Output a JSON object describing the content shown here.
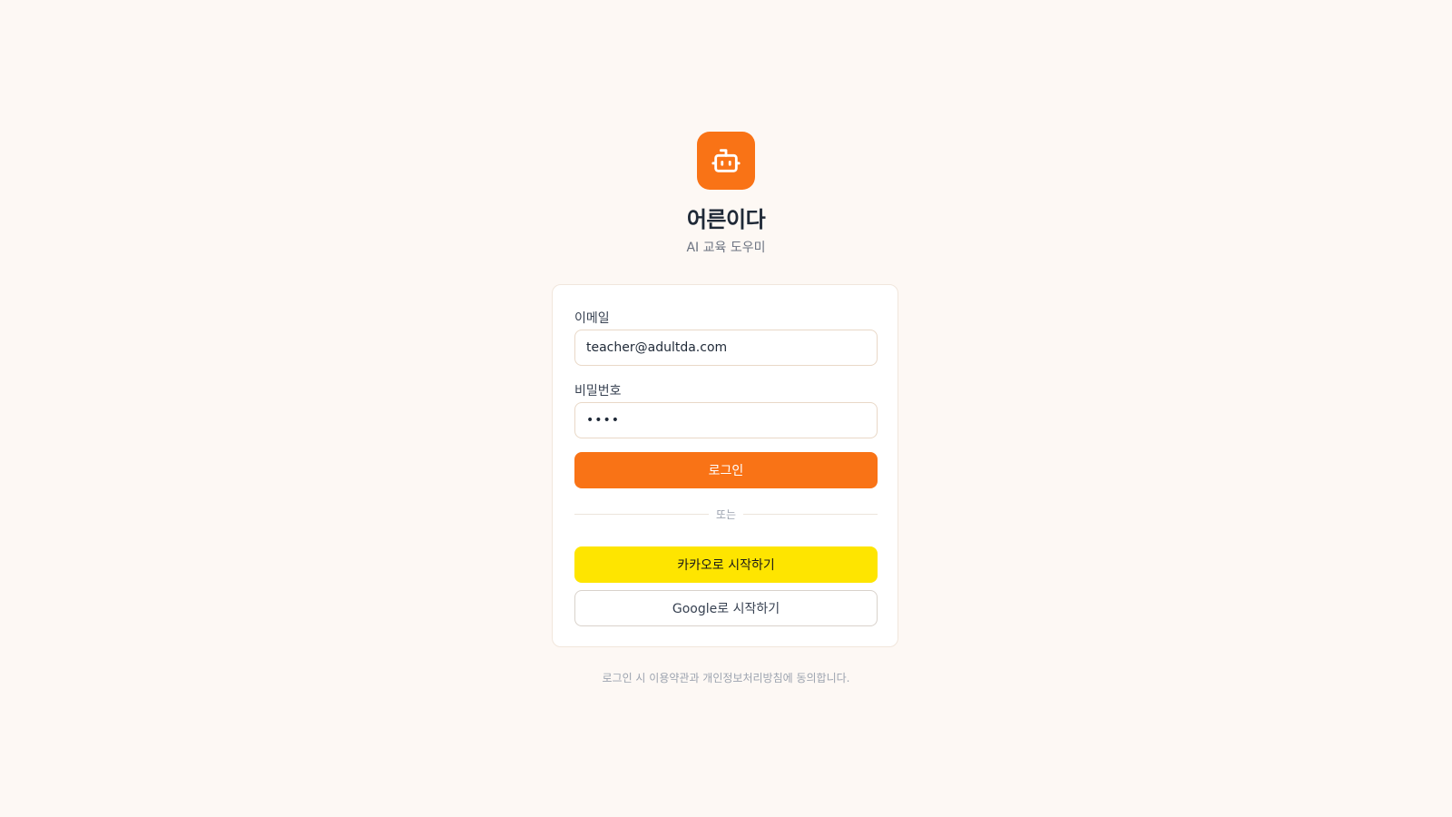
{
  "brand": {
    "logo_icon": "robot-icon",
    "title": "어른이다",
    "subtitle": "AI 교육 도우미"
  },
  "login_form": {
    "email_label": "이메일",
    "email_value": "teacher@adultda.com",
    "password_label": "비밀번호",
    "password_value": "••••",
    "login_button": "로그인",
    "divider_text": "또는",
    "kakao_button": "카카오로 시작하기",
    "google_button": "Google로 시작하기"
  },
  "footer": {
    "terms_text": "로그인 시 이용약관과 개인정보처리방침에 동의합니다."
  },
  "colors": {
    "accent": "#f97316",
    "kakao": "#fee500",
    "background": "#fdf8f4"
  }
}
